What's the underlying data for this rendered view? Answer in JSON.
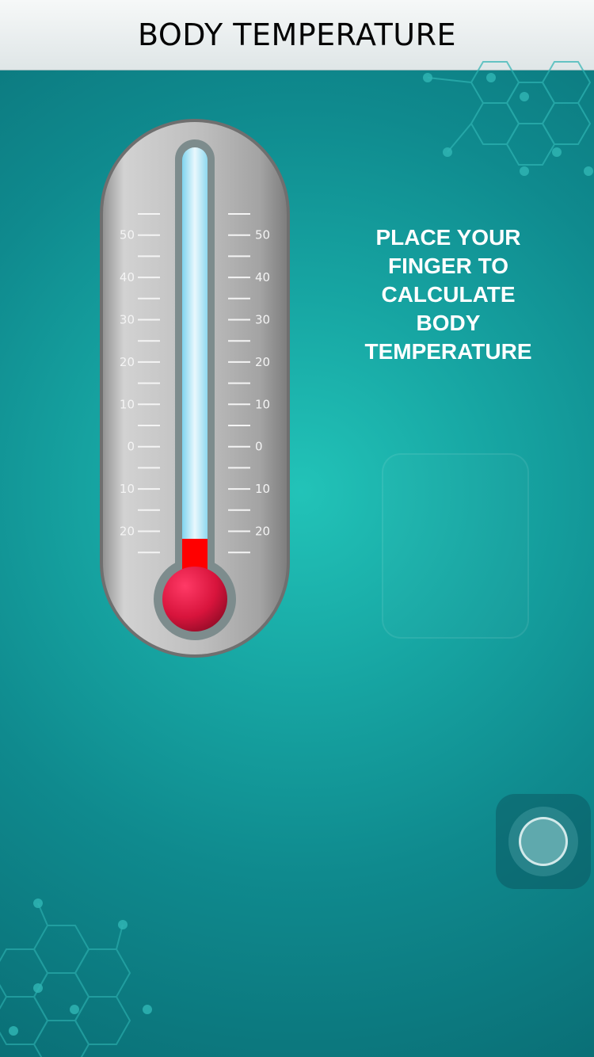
{
  "header": {
    "title": "BODY TEMPERATURE"
  },
  "instruction": {
    "text": "PLACE YOUR\nFINGER TO\nCALCULATE\nBODY\nTEMPERATURE"
  },
  "thermometer": {
    "left_scale": [
      "50",
      "40",
      "30",
      "20",
      "10",
      "0",
      "10",
      "20"
    ],
    "right_scale": [
      "50",
      "40",
      "30",
      "20",
      "10",
      "0",
      "10",
      "20"
    ],
    "mercury_color": "#ff0000",
    "bulb_color": "#d8143c"
  },
  "icons": {
    "home": "home-button-icon",
    "fingerprint": "fingerprint-pad-icon"
  },
  "colors": {
    "background": "#17a6a3",
    "header": "#e9eeef",
    "text": "#ffffff"
  }
}
